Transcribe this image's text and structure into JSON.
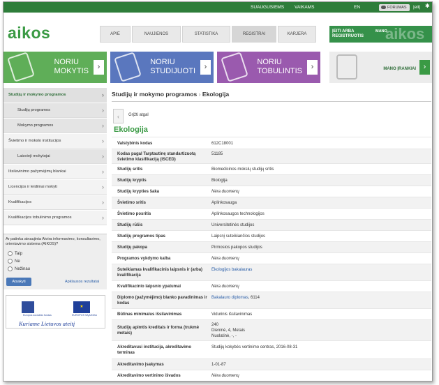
{
  "topbar": {
    "suaugusiems": "SUAUGUSIEMS",
    "vaikams": "VAIKAMS",
    "lang": "EN",
    "forum": "FORUMAS",
    "info": "|eit|"
  },
  "logo": "aikos",
  "nav": [
    "APIE",
    "NAUJIENOS",
    "STATISTIKA",
    "REGISTRAI",
    "KARJERA"
  ],
  "login": {
    "label": "ĮEITI ARBA REGISTRUOTIS",
    "mano": "MANO",
    "big": "aikos"
  },
  "banners": [
    {
      "line1": "NORIU",
      "line2": "MOKYTIS",
      "color": "#5fae58"
    },
    {
      "line1": "NORIU",
      "line2": "STUDIJUOTI",
      "color": "#5a77be"
    },
    {
      "line1": "NORIU",
      "line2": "TOBULINTIS",
      "color": "#9a5aae"
    },
    {
      "line1": "MANO ĮRANKIAI",
      "line2": ""
    }
  ],
  "sidebar": [
    {
      "label": "Studijų ir mokymo programos",
      "active": true
    },
    {
      "label": "Studijų programos",
      "sub": true
    },
    {
      "label": "Mokymo programos",
      "sub": true
    },
    {
      "label": "Švietimo ir mokslo institucijos"
    },
    {
      "label": "Laisvieji mokytojai",
      "sub": true
    },
    {
      "label": "Išsilavinimo pažymėjimų blankai"
    },
    {
      "label": "Licencijos ir leidimai mokyti"
    },
    {
      "label": "Kvalifikacijos"
    },
    {
      "label": "Kvalifikacijos tobulinimo programos"
    }
  ],
  "survey": {
    "question": "Ar patinka atnaujinta Atvira informavimo, konsultavimo, orientavimo sistema (AIKOS)?",
    "options": [
      "Taip",
      "Ne",
      "Nežinau"
    ],
    "submit": "Atsakyti",
    "results": "Apklausos rezultatai"
  },
  "esf": {
    "fund": "Europos socialinis fondas",
    "eu": "EUROPOS SĄJUNGA",
    "slogan": "Kuriame Lietuvos ateitį"
  },
  "breadcrumb": {
    "parent": "Studijų ir mokymo programos",
    "sep": "›",
    "current": "Ekologija"
  },
  "back_label": "Grįžti atgal",
  "heading": "Ekologija",
  "rows": [
    {
      "label": "Valstybinis kodas",
      "value": "612C18001"
    },
    {
      "label": "Kodas pagal Tarptautinę standartizuotą švietimo klasifikaciją (ISCED)",
      "value": "51185"
    },
    {
      "label": "Studijų sritis",
      "value": "Biomedicinos mokslų studijų sritis"
    },
    {
      "label": "Studijų kryptis",
      "value": "Biologija"
    },
    {
      "label": "Studijų krypties šaka",
      "value": "Nėra duomenų",
      "italic": true
    },
    {
      "label": "Švietimo sritis",
      "value": "Aplinkosauga"
    },
    {
      "label": "Švietimo posritis",
      "value": "Aplinkosaugos technologijos"
    },
    {
      "label": "Studijų rūšis",
      "value": "Universitetinės studijos"
    },
    {
      "label": "Studijų programos tipas",
      "value": "Laipsnį suteikiančios studijos"
    },
    {
      "label": "Studijų pakopa",
      "value": "Pirmosios pakopos studijos"
    },
    {
      "label": "Programos vykdymo kalba",
      "value": "Nėra duomenų",
      "italic": true
    },
    {
      "label": "Suteikiamas kvalifikacinis laipsnis ir (arba) kvalifikacija",
      "value": "Ekologijos bakalauras",
      "link": true
    },
    {
      "label": "Kvalifikacinio laipsnio ypatumai",
      "value": "Nėra duomenų",
      "italic": true
    },
    {
      "label": "Diplomo (pažymėjimo) blanko pavadinimas ir kodas",
      "value": "Bakalauro diplomas",
      "suffix": ", 6114",
      "link": true
    },
    {
      "label": "Būtinas minimalus išsilavinimas",
      "value": "Vidurinis išsilavinimas"
    },
    {
      "label": "Studijų apimtis kreditais ir forma (trukmė metais)",
      "value": "240",
      "value2": "Dieninė, 4, Metais",
      "value3": "Nuolatinė, -, -"
    },
    {
      "label": "Akreditavusi institucija, akreditavimo terminas",
      "value": "Studijų kokybės vertinimo centras, 2016-08-31"
    },
    {
      "label": "Akreditavimo įsakymas",
      "value": "1-01-87"
    },
    {
      "label": "Akreditavimo vertinimo išvados",
      "value": "Nėra duomenų",
      "italic": true
    }
  ]
}
